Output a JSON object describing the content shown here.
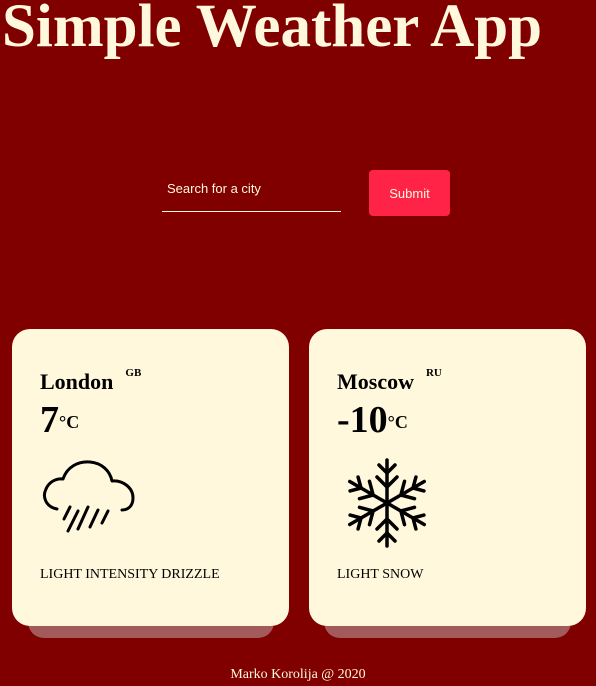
{
  "header": {
    "title": "Simple Weather App"
  },
  "search": {
    "placeholder": "Search for a city",
    "value": "",
    "submit_label": "Submit"
  },
  "cards": [
    {
      "city": "London",
      "country": "GB",
      "temperature": "7",
      "unit": "°C",
      "icon": "rain-cloud-icon",
      "description": "LIGHT INTENSITY DRIZZLE"
    },
    {
      "city": "Moscow",
      "country": "RU",
      "temperature": "-10",
      "unit": "°C",
      "icon": "snowflake-icon",
      "description": "LIGHT SNOW"
    }
  ],
  "footer": {
    "text": "Marko Korolija @ 2020"
  },
  "colors": {
    "background": "#800000",
    "card": "#fff8dc",
    "accent": "#ff2347",
    "text_light": "#fff8dc"
  }
}
